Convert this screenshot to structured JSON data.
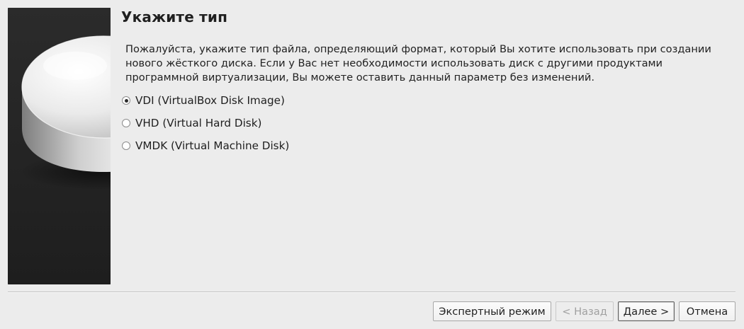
{
  "wizard": {
    "title": "Укажите тип",
    "description": "Пожалуйста, укажите тип файла, определяющий формат, который Вы хотите использовать при создании нового жёсткого диска. Если у Вас нет необходимости использовать диск с другими продуктами программной виртуализации, Вы можете оставить данный параметр без изменений.",
    "banner_icon": "hard-disk-icon"
  },
  "disk_types": [
    {
      "label": "VDI (VirtualBox Disk Image)",
      "checked": true
    },
    {
      "label": "VHD (Virtual Hard Disk)",
      "checked": false
    },
    {
      "label": "VMDK (Virtual Machine Disk)",
      "checked": false
    }
  ],
  "buttons": {
    "expert_mode": "Экспертный режим",
    "back": "< Назад",
    "next": "Далее >",
    "cancel": "Отмена"
  }
}
